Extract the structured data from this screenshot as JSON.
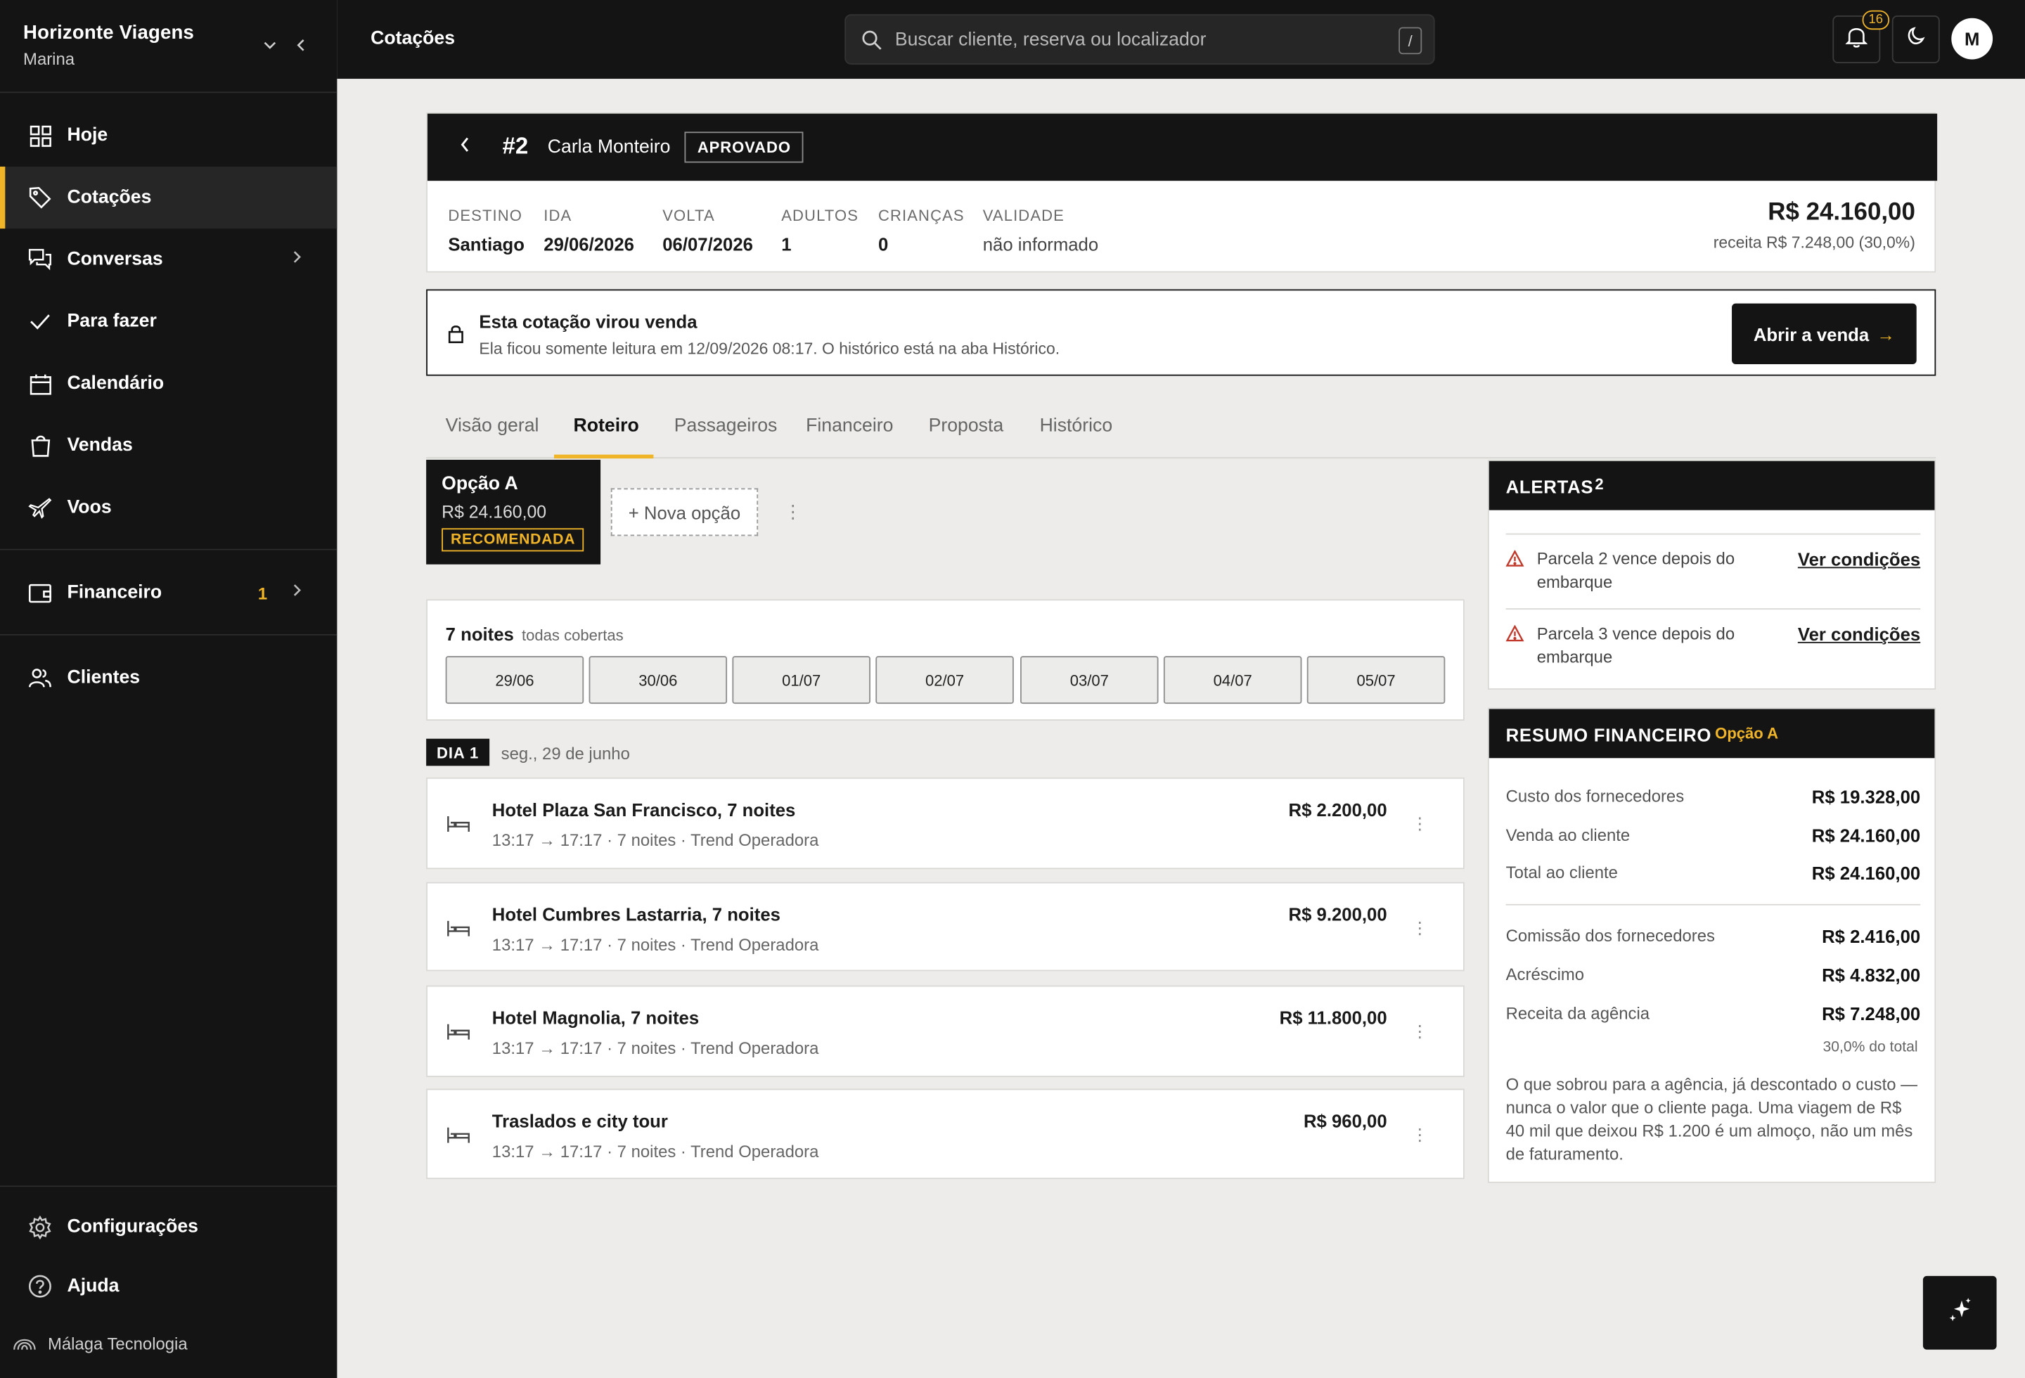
{
  "sidebar": {
    "org": "Horizonte Viagens",
    "user": "Marina",
    "items": [
      {
        "label": "Hoje",
        "icon": "grid-icon"
      },
      {
        "label": "Cotações",
        "icon": "tag-icon"
      },
      {
        "label": "Conversas",
        "icon": "chat-icon"
      },
      {
        "label": "Para fazer",
        "icon": "check-icon"
      },
      {
        "label": "Calendário",
        "icon": "calendar-icon"
      },
      {
        "label": "Vendas",
        "icon": "bag-icon"
      },
      {
        "label": "Voos",
        "icon": "plane-icon"
      },
      {
        "label": "Financeiro",
        "icon": "wallet-icon",
        "badge": "1"
      },
      {
        "label": "Clientes",
        "icon": "users-icon"
      },
      {
        "label": "Configurações",
        "icon": "gear-icon"
      },
      {
        "label": "Ajuda",
        "icon": "help-icon"
      }
    ],
    "footer": "Málaga Tecnologia"
  },
  "topbar": {
    "title": "Cotações",
    "search_placeholder": "Buscar cliente, reserva ou localizador",
    "search_shortcut": "/",
    "notifications": "16",
    "avatar": "M"
  },
  "quote": {
    "number": "#2",
    "client": "Carla Monteiro",
    "status": "APROVADO",
    "fields": [
      {
        "label": "DESTINO",
        "value": "Santiago"
      },
      {
        "label": "IDA",
        "value": "29/06/2026"
      },
      {
        "label": "VOLTA",
        "value": "06/07/2026"
      },
      {
        "label": "ADULTOS",
        "value": "1"
      },
      {
        "label": "CRIANÇAS",
        "value": "0"
      },
      {
        "label": "VALIDADE",
        "value": "não informado"
      }
    ],
    "total": "R$ 24.160,00",
    "revenue": "receita R$ 7.248,00 (30,0%)"
  },
  "banner": {
    "title": "Esta cotação virou venda",
    "subtitle": "Ela ficou somente leitura em 12/09/2026 08:17. O histórico está na aba Histórico.",
    "button": "Abrir a venda",
    "button_arrow": "→"
  },
  "tabs": [
    "Visão geral",
    "Roteiro",
    "Passageiros",
    "Financeiro",
    "Proposta",
    "Histórico"
  ],
  "active_tab": "Roteiro",
  "options": {
    "current_name": "Opção A",
    "current_price": "R$ 24.160,00",
    "current_badge": "RECOMENDADA",
    "new_option": "+ Nova opção"
  },
  "nights": {
    "title": "7 noites",
    "subtitle": "todas cobertas",
    "days": [
      "29/06",
      "30/06",
      "01/07",
      "02/07",
      "03/07",
      "04/07",
      "05/07"
    ]
  },
  "day": {
    "tag": "DIA 1",
    "date": "seg., 29 de junho"
  },
  "items": [
    {
      "title": "Hotel Plaza San Francisco, 7 noites",
      "sub": "13:17 → 17:17 · 7 noites · Trend Operadora",
      "price": "R$ 2.200,00"
    },
    {
      "title": "Hotel Cumbres Lastarria, 7 noites",
      "sub": "13:17 → 17:17 · 7 noites · Trend Operadora",
      "price": "R$ 9.200,00"
    },
    {
      "title": "Hotel Magnolia, 7 noites",
      "sub": "13:17 → 17:17 · 7 noites · Trend Operadora",
      "price": "R$ 11.800,00"
    },
    {
      "title": "Traslados e city tour",
      "sub": "13:17 → 17:17 · 7 noites · Trend Operadora",
      "price": "R$ 960,00"
    }
  ],
  "alerts": {
    "title": "ALERTAS",
    "count": "2",
    "rows": [
      {
        "text": "Parcela 2 vence depois do embarque",
        "link": "Ver condições"
      },
      {
        "text": "Parcela 3 vence depois do embarque",
        "link": "Ver condições"
      }
    ]
  },
  "finance": {
    "title": "RESUMO FINANCEIRO",
    "option": "Opção A",
    "rows": [
      {
        "label": "Custo dos fornecedores",
        "value": "R$ 19.328,00"
      },
      {
        "label": "Venda ao cliente",
        "value": "R$ 24.160,00"
      },
      {
        "label": "Total ao cliente",
        "value": "R$ 24.160,00"
      },
      {
        "label": "Comissão dos fornecedores",
        "value": "R$ 2.416,00"
      },
      {
        "label": "Acréscimo",
        "value": "R$ 4.832,00"
      },
      {
        "label": "Receita da agência",
        "value": "R$ 7.248,00"
      }
    ],
    "pct": "30,0% do total",
    "note": "O que sobrou para a agência, já descontado o custo — nunca o valor que o cliente paga. Uma viagem de R$ 40 mil que deixou R$ 1.200 é um almoço, não um mês de faturamento."
  },
  "colors": {
    "accent": "#f0b429",
    "dark": "#141414",
    "background": "#edecea",
    "alert": "#c0392b"
  }
}
